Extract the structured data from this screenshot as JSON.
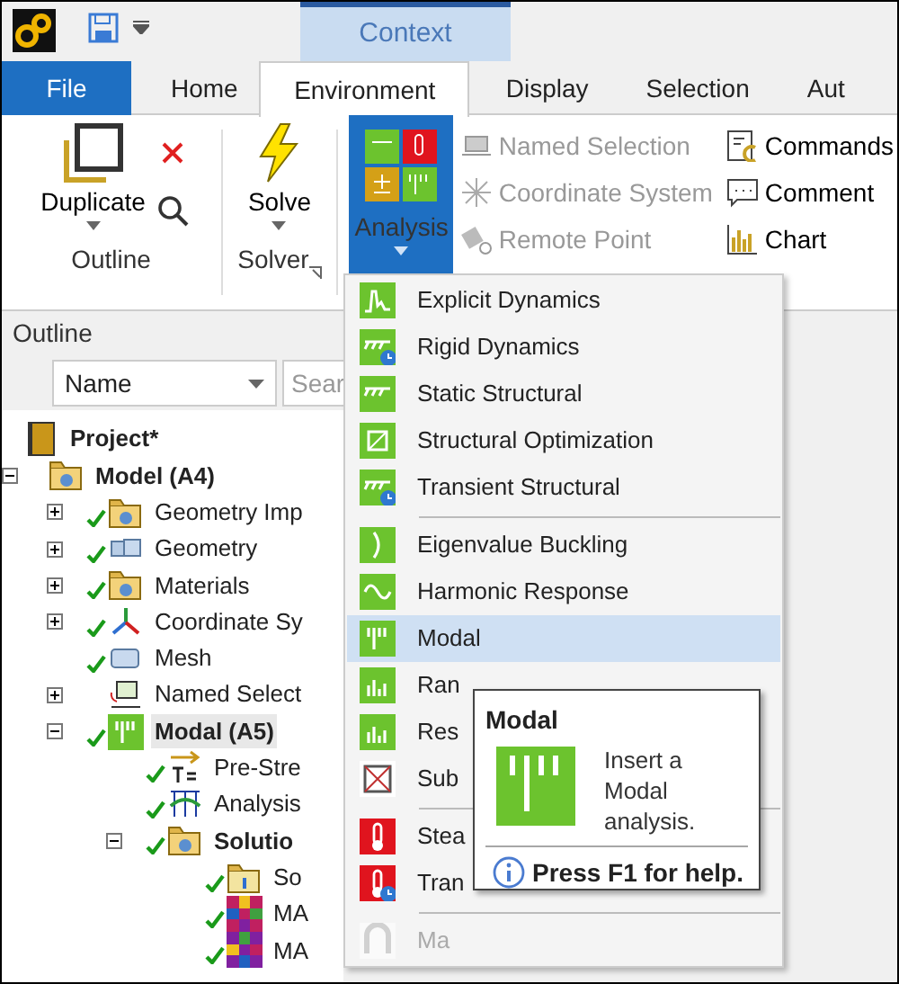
{
  "context_tab": {
    "label": "Context"
  },
  "tabs": [
    {
      "label": "File",
      "kind": "file",
      "selected": false
    },
    {
      "label": "Home",
      "kind": "tab",
      "selected": false
    },
    {
      "label": "Environment",
      "kind": "tab",
      "selected": true
    },
    {
      "label": "Display",
      "kind": "tab",
      "selected": false
    },
    {
      "label": "Selection",
      "kind": "tab",
      "selected": false
    },
    {
      "label": "Aut",
      "kind": "tab",
      "selected": false
    }
  ],
  "ribbon": {
    "outline_group": {
      "label": "Outline",
      "duplicate": "Duplicate"
    },
    "solver_group": {
      "label": "Solver",
      "solve": "Solve"
    },
    "analysis_button": {
      "label": "Analysis",
      "selected": true
    },
    "insert_buttons": [
      {
        "label": "Named Selection",
        "disabled": true
      },
      {
        "label": "Coordinate System",
        "disabled": true
      },
      {
        "label": "Remote Point",
        "disabled": true
      }
    ],
    "other_buttons": [
      {
        "label": "Commands"
      },
      {
        "label": "Comment"
      },
      {
        "label": "Chart"
      }
    ]
  },
  "outline": {
    "title": "Outline",
    "filter": "Name",
    "search": {
      "placeholder": "Sear"
    },
    "tree": [
      {
        "label": "Project*",
        "bold": true,
        "check": false,
        "selected": false,
        "children": [
          {
            "label": "Model (A4)",
            "bold": true,
            "check": false,
            "selected": false,
            "expanded": true,
            "children": [
              {
                "label": "Geometry Imp",
                "bold": false,
                "check": true,
                "selected": false,
                "expanded": false
              },
              {
                "label": "Geometry",
                "bold": false,
                "check": true,
                "selected": false,
                "expanded": false
              },
              {
                "label": "Materials",
                "bold": false,
                "check": true,
                "selected": false,
                "expanded": false
              },
              {
                "label": "Coordinate Sy",
                "bold": false,
                "check": true,
                "selected": false,
                "expanded": false
              },
              {
                "label": "Mesh",
                "bold": false,
                "check": true,
                "selected": false
              },
              {
                "label": "Named Select",
                "bold": false,
                "check": false,
                "selected": false,
                "expanded": false
              },
              {
                "label": "Modal (A5)",
                "bold": true,
                "check": true,
                "selected": true,
                "expanded": true,
                "children": [
                  {
                    "label": "Pre-Stre",
                    "bold": false,
                    "check": true,
                    "selected": false
                  },
                  {
                    "label": "Analysis",
                    "bold": false,
                    "check": true,
                    "selected": false
                  },
                  {
                    "label": "Solutio",
                    "bold": true,
                    "check": true,
                    "selected": false,
                    "expanded": true,
                    "children": [
                      {
                        "label": "So",
                        "bold": false,
                        "check": true,
                        "selected": false
                      },
                      {
                        "label": "MA",
                        "bold": false,
                        "check": true,
                        "selected": false
                      },
                      {
                        "label": "MA",
                        "bold": false,
                        "check": true,
                        "selected": false
                      }
                    ]
                  }
                ]
              }
            ]
          }
        ]
      }
    ]
  },
  "analysis_menu": {
    "groups": [
      [
        {
          "label": "Explicit Dynamics",
          "selected": false,
          "disabled": false
        },
        {
          "label": "Rigid Dynamics",
          "selected": false,
          "disabled": false
        },
        {
          "label": "Static Structural",
          "selected": false,
          "disabled": false
        },
        {
          "label": "Structural Optimization",
          "selected": false,
          "disabled": false
        },
        {
          "label": "Transient Structural",
          "selected": false,
          "disabled": false
        }
      ],
      [
        {
          "label": "Eigenvalue Buckling",
          "selected": false,
          "disabled": false
        },
        {
          "label": "Harmonic Response",
          "selected": false,
          "disabled": false
        },
        {
          "label": "Modal",
          "selected": true,
          "disabled": false
        },
        {
          "label": "Ran",
          "selected": false,
          "disabled": false
        },
        {
          "label": "Res",
          "selected": false,
          "disabled": false
        },
        {
          "label": "Sub",
          "selected": false,
          "disabled": false
        }
      ],
      [
        {
          "label": "Stea",
          "selected": false,
          "disabled": false
        },
        {
          "label": "Tran",
          "selected": false,
          "disabled": false
        }
      ],
      [
        {
          "label": "Ma",
          "selected": false,
          "disabled": true
        }
      ]
    ]
  },
  "tooltip": {
    "title": "Modal",
    "description": "Insert a Modal analysis.",
    "help": "Press F1 for help."
  }
}
